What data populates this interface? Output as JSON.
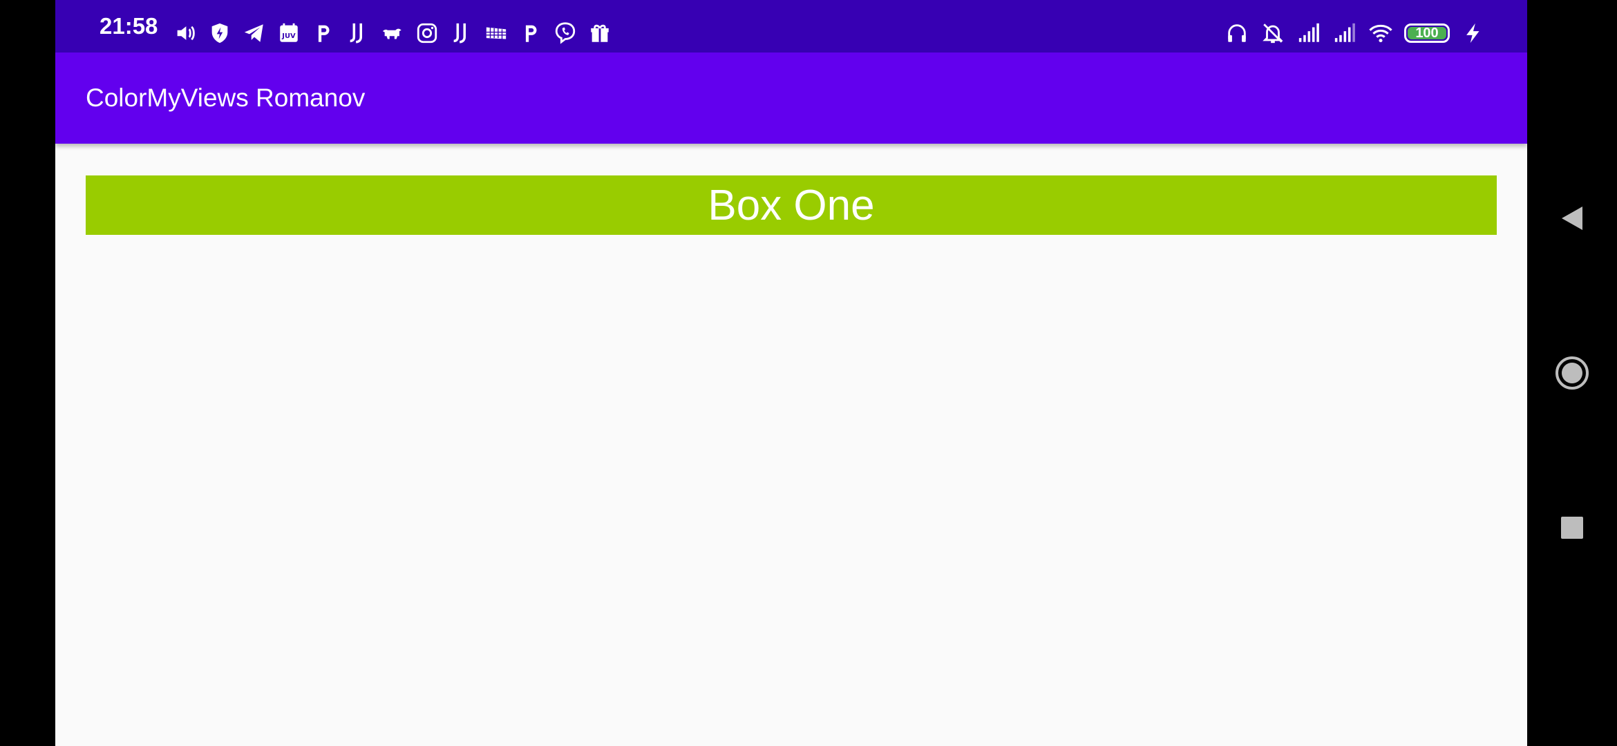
{
  "status_bar": {
    "time": "21:58",
    "left_icons": [
      "volume-icon",
      "shield-bolt-icon",
      "telegram-icon",
      "juventus-calendar-icon",
      "p-icon",
      "juventus-icon",
      "bull-icon",
      "instagram-icon",
      "juventus-icon",
      "stadium-icon",
      "p-icon",
      "viber-icon",
      "gift-icon"
    ],
    "right_icons": [
      "headphones-icon",
      "bell-off-icon",
      "signal-icon",
      "signal-icon",
      "wifi-icon"
    ],
    "battery_level": "100",
    "charging": true
  },
  "toolbar": {
    "title": "ColorMyViews Romanov"
  },
  "box_one": {
    "label": "Box One",
    "color": "#99cc00"
  },
  "colors": {
    "status_bar": "#3700b3",
    "toolbar": "#6200ee",
    "background": "#fafafa"
  },
  "nav_bar": {
    "buttons": [
      "back-icon",
      "home-icon",
      "recents-icon"
    ]
  }
}
